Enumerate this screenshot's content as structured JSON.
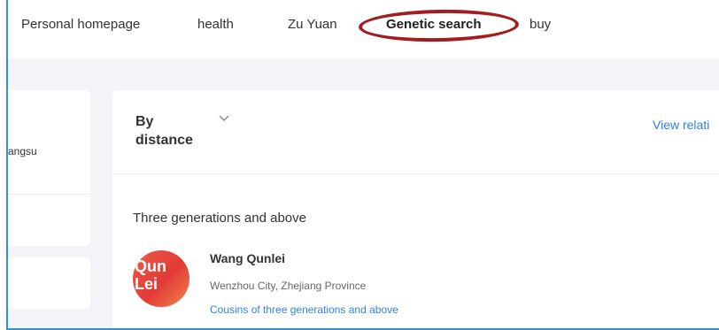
{
  "nav": {
    "items": [
      {
        "label": "Personal homepage",
        "active": false
      },
      {
        "label": "health",
        "active": false
      },
      {
        "label": "Zu Yuan",
        "active": false
      },
      {
        "label": "Genetic search",
        "active": true
      },
      {
        "label": "buy",
        "active": false
      }
    ]
  },
  "left_panel": {
    "location_fragment": "angsu"
  },
  "main": {
    "sort_label": "By distance",
    "view_link": "View relati",
    "section_title": "Three generations and above",
    "person": {
      "avatar_line1": "Qun",
      "avatar_line2": "Lei",
      "name": "Wang Qunlei",
      "location": "Wenzhou City, Zhejiang Province",
      "relation": "Cousins of three generations and above"
    }
  },
  "colors": {
    "accent_link": "#2f80e8",
    "highlight_ring": "#a31c1f",
    "frame_border": "#2f8fd8",
    "page_background": "#f3f4f7"
  }
}
